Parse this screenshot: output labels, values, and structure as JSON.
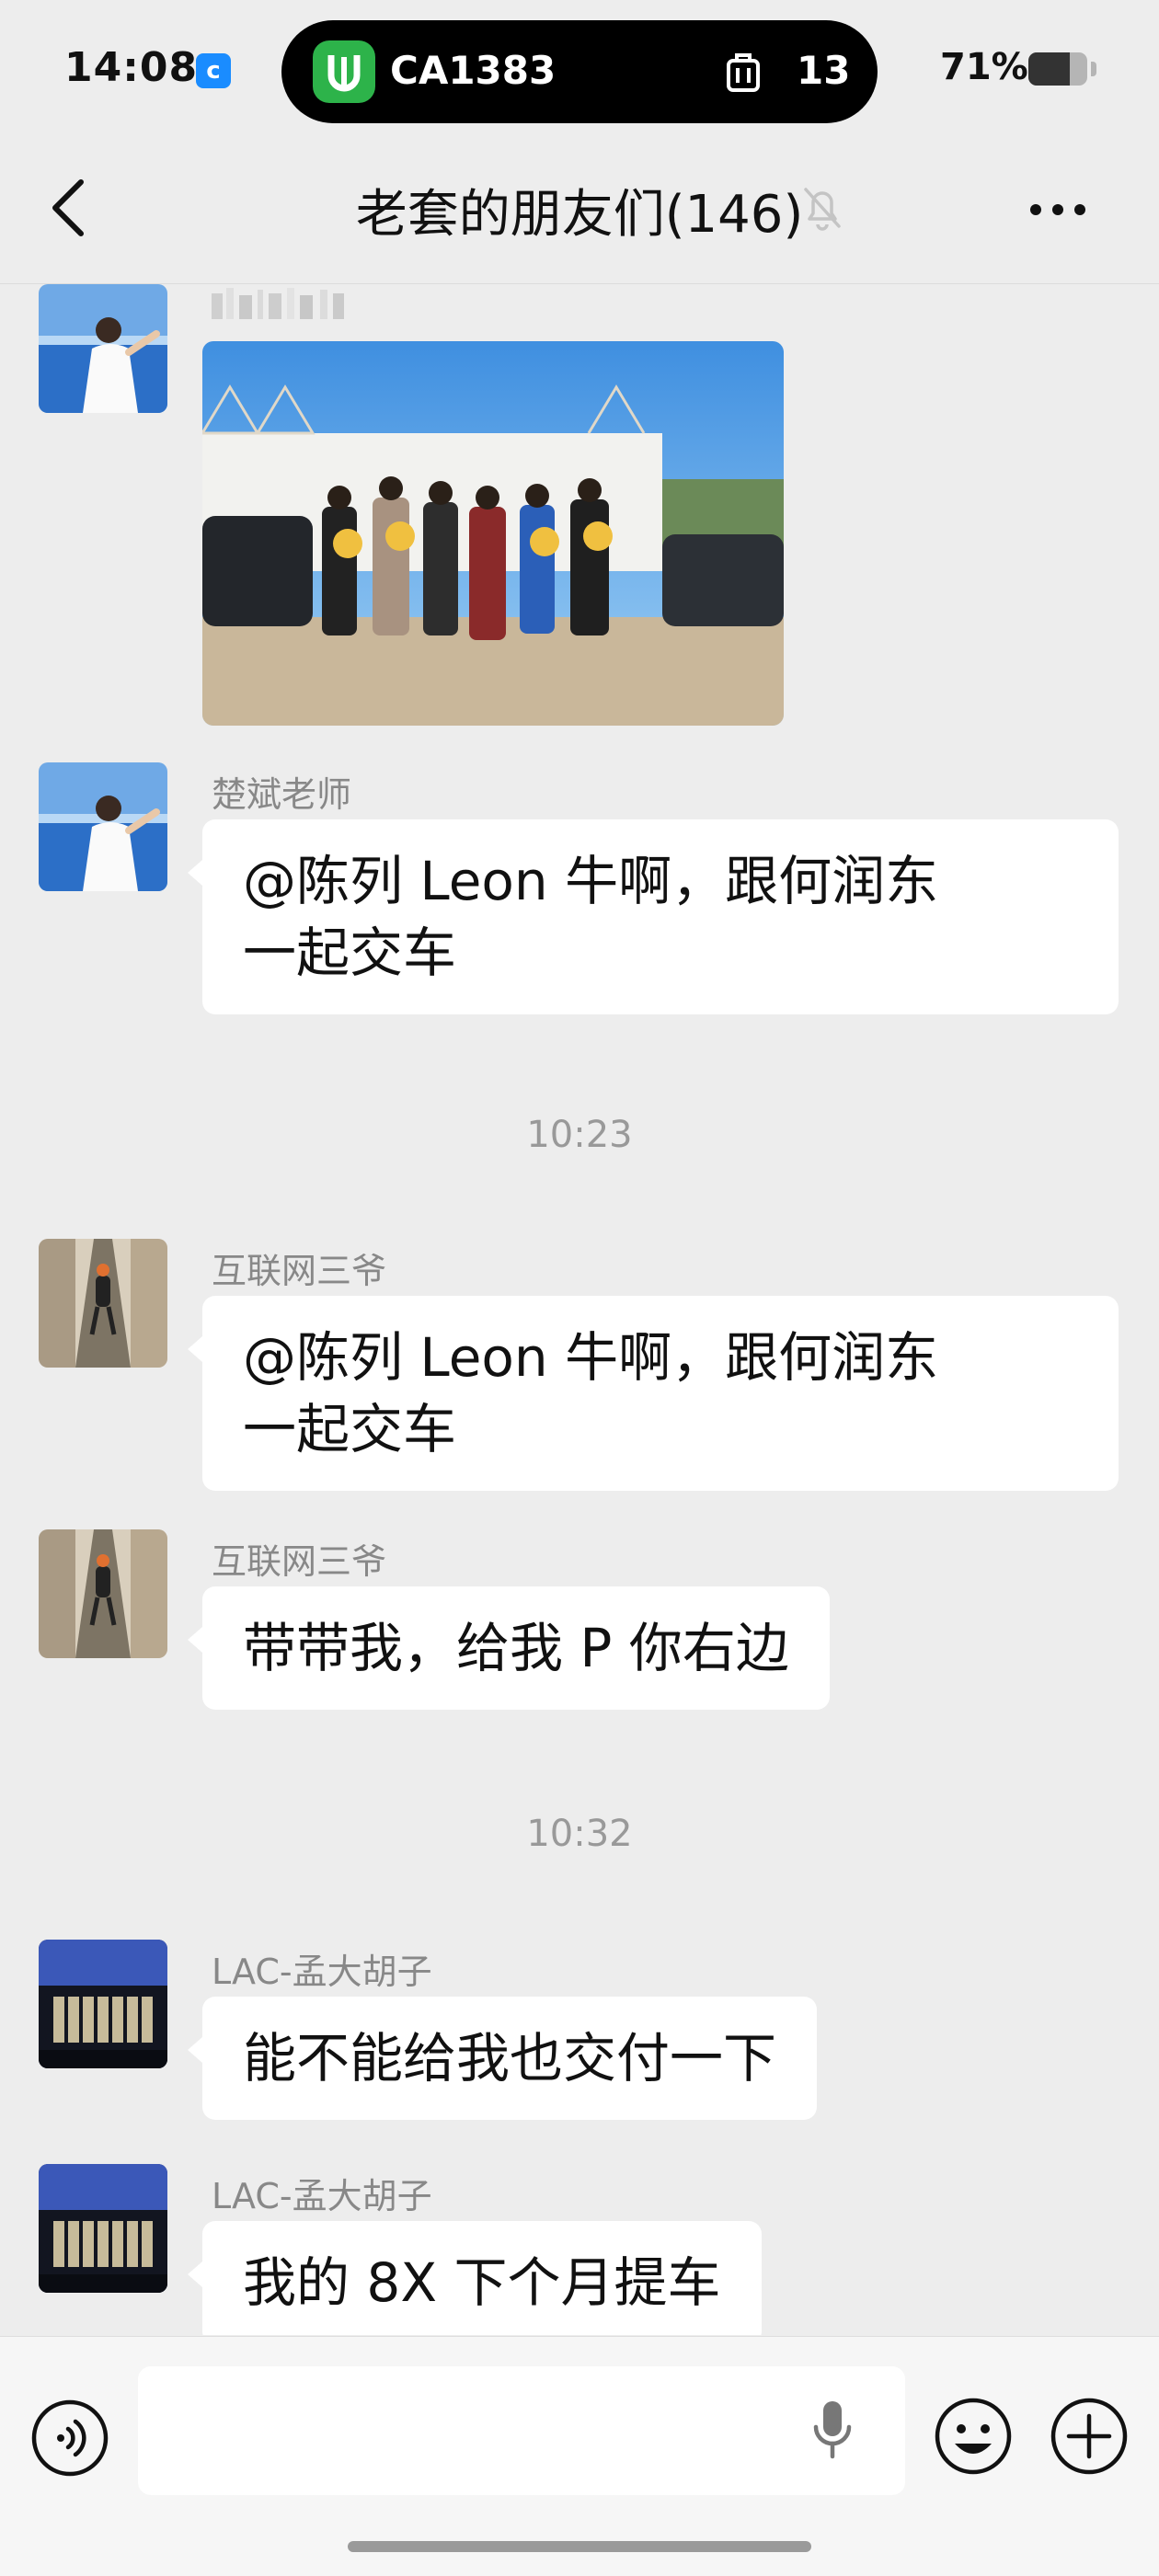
{
  "status_bar": {
    "time": "14:08",
    "notification_badge": "c",
    "flight_number": "CA1383",
    "gate_number": "13",
    "battery_percent": "71%",
    "battery_level": 0.71
  },
  "header": {
    "title": "老套的朋友们(146)",
    "muted": true
  },
  "messages": [
    {
      "type": "image",
      "sender": "",
      "avatar": "sea-avatar",
      "content": "car delivery group photo"
    },
    {
      "type": "text",
      "sender": "楚斌老师",
      "avatar": "sea-avatar",
      "line1": "@陈列 Leon  牛啊，跟何润东",
      "line2": "一起交车"
    },
    {
      "type": "time",
      "text": "10:23"
    },
    {
      "type": "text",
      "sender": "互联网三爷",
      "avatar": "alley-avatar",
      "line1": "@陈列 Leon  牛啊，跟何润东",
      "line2": "一起交车"
    },
    {
      "type": "text",
      "sender": "互联网三爷",
      "avatar": "alley-avatar",
      "line1": "带带我，给我 P 你右边"
    },
    {
      "type": "time",
      "text": "10:32"
    },
    {
      "type": "text",
      "sender": "LAC-孟大胡子",
      "avatar": "building-avatar",
      "line1": "能不能给我也交付一下"
    },
    {
      "type": "text",
      "sender": "LAC-孟大胡子",
      "avatar": "building-avatar",
      "line1": "我的 8X 下个月提车"
    }
  ],
  "input_bar": {
    "voice_icon": "voice-toggle-icon",
    "mic_icon": "microphone-icon",
    "emoji_icon": "emoji-icon",
    "plus_icon": "plus-icon"
  },
  "colors": {
    "background": "#ededed",
    "bubble": "#ffffff",
    "sender_text": "#888888",
    "timestamp_text": "#999999",
    "flight_app": "#2db34a"
  }
}
